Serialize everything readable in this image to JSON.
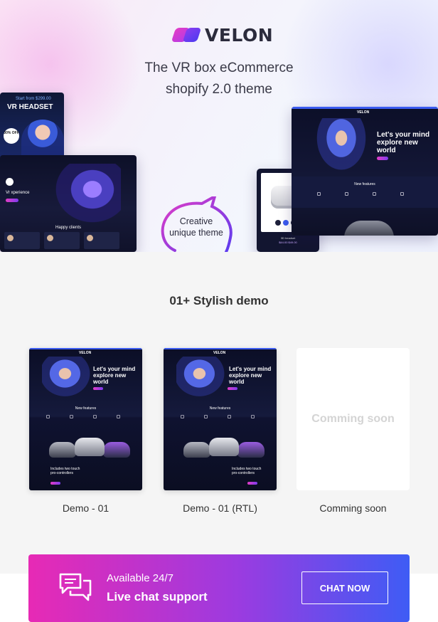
{
  "brand": {
    "name": "VELON"
  },
  "hero": {
    "tagline_line1": "The VR box eCommerce",
    "tagline_line2": "shopify 2.0 theme",
    "bubble_line1": "Creative",
    "bubble_line2": "unique theme",
    "vr_card": {
      "small": "Start from $299.00",
      "title": "VR HEADSET",
      "badge": "30% OFF"
    },
    "dark_site": {
      "headline": "Vr xperience",
      "section": "Happy clients"
    },
    "right_site": {
      "headline": "Let's your mind explore new world",
      "section": "New features"
    },
    "tablet": {
      "product": "3D headset",
      "price": "$44.00  $49.00"
    }
  },
  "demos": {
    "title": "01+ Stylish demo",
    "preview": {
      "headline": "Let's your mind explore new world",
      "section": "New features",
      "sub": "Includes two touch pro-controllers"
    },
    "items": [
      {
        "label": "Demo - 01"
      },
      {
        "label": "Demo - 01 (RTL)"
      },
      {
        "label": "Comming soon",
        "placeholder": "Comming soon"
      }
    ]
  },
  "chat": {
    "available": "Available 24/7",
    "live": "Live chat support",
    "button": "CHAT NOW",
    "icon": "chat-bubbles-icon"
  },
  "colors": {
    "accent_pink": "#e72ab5",
    "accent_blue": "#3e5cf5",
    "dark_navy": "#0b0e26"
  }
}
